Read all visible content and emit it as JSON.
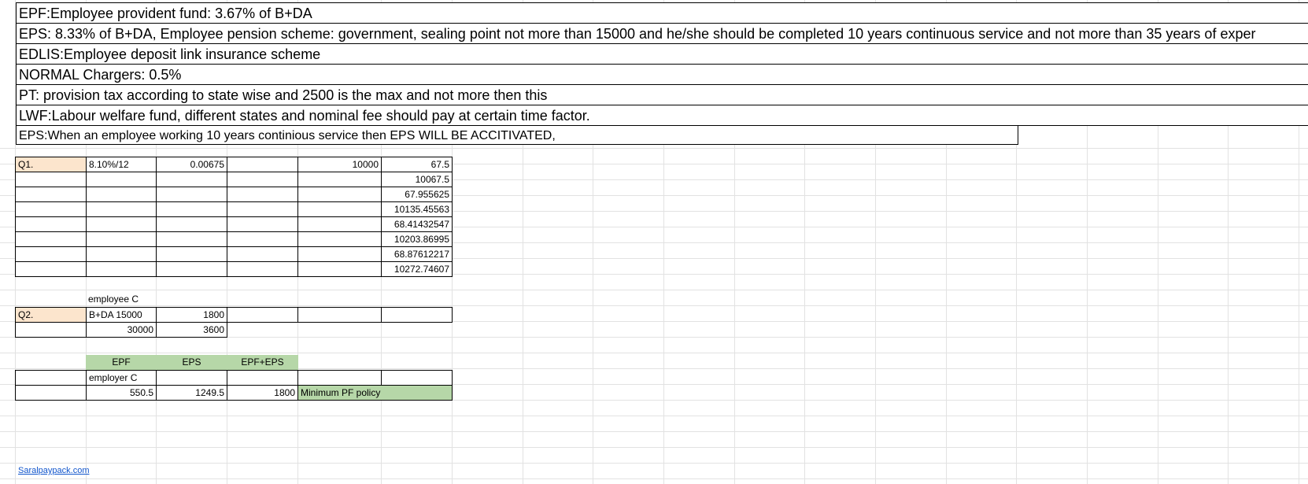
{
  "notes": [
    "EPF:Employee provident fund: 3.67% of B+DA",
    "EPS: 8.33%  of B+DA, Employee pension scheme: government, sealing point not more than 15000 and he/she should be completed 10 years continuous service and not more than 35 years of exper",
    "EDLIS:Employee deposit link insurance scheme",
    "NORMAL Chargers: 0.5%",
    "PT: provision tax according to state wise and 2500 is the max and not more then this",
    "LWF:Labour welfare fund, different states and nominal fee should pay at certain time factor.",
    "EPS:When an employee working 10 years continious service then EPS WILL BE ACCITIVATED,"
  ],
  "q1": {
    "label": "Q1.",
    "rate": "8.10%/12",
    "monthly_rate": "0.00675",
    "principal": "10000",
    "results": [
      "67.5",
      "10067.5",
      "67.955625",
      "10135.45563",
      "68.41432547",
      "10203.86995",
      "68.87612217",
      "10272.74607"
    ]
  },
  "q2": {
    "header": "employee C",
    "label": "Q2.",
    "row1": [
      "B+DA 15000",
      "1800"
    ],
    "row2": [
      "30000",
      "3600"
    ]
  },
  "employer": {
    "headers": [
      "EPF",
      "EPS",
      "EPF+EPS"
    ],
    "label": "employer C",
    "values": [
      "550.5",
      "1249.5",
      "1800"
    ],
    "policy": "Minimum PF policy"
  },
  "footer_link": "Saralpaypack.com",
  "colors": {
    "peach": "#fce5cd",
    "green": "#b6d7a8",
    "link": "#1155cc",
    "grid": "#e2e2e2"
  }
}
